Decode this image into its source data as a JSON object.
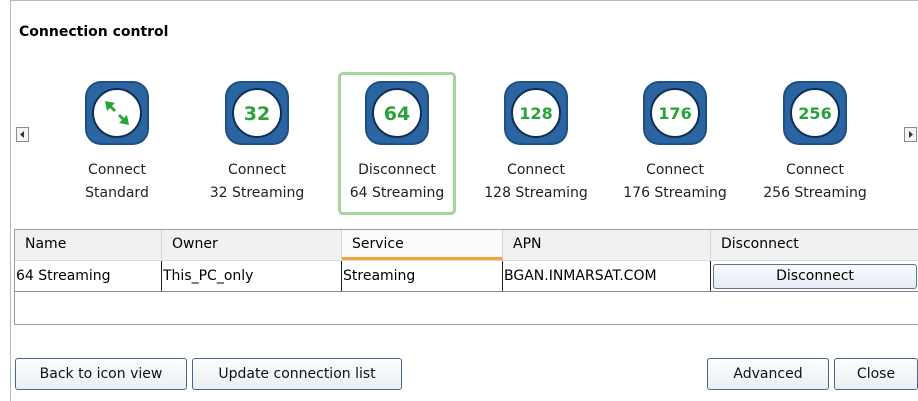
{
  "window": {
    "title": "Connection control"
  },
  "connections": [
    {
      "line1": "Connect",
      "line2": "Standard",
      "badge": "",
      "icon": "standard-connection-icon"
    },
    {
      "line1": "Connect",
      "line2": "32 Streaming",
      "badge": "32",
      "icon": "streaming-32-icon"
    },
    {
      "line1": "Disconnect",
      "line2": "64 Streaming",
      "badge": "64",
      "icon": "streaming-64-icon",
      "selected": true
    },
    {
      "line1": "Connect",
      "line2": "128 Streaming",
      "badge": "128",
      "icon": "streaming-128-icon"
    },
    {
      "line1": "Connect",
      "line2": "176 Streaming",
      "badge": "176",
      "icon": "streaming-176-icon"
    },
    {
      "line1": "Connect",
      "line2": "256 Streaming",
      "badge": "256",
      "icon": "streaming-256-icon"
    }
  ],
  "table": {
    "columns": [
      "Name",
      "Owner",
      "Service",
      "APN",
      "Disconnect"
    ],
    "sorted_column": "Service",
    "rows": [
      {
        "name": "64 Streaming",
        "owner": "This_PC_only",
        "service": "Streaming",
        "apn": "BGAN.INMARSAT.COM",
        "action": "Disconnect"
      }
    ]
  },
  "buttons": {
    "back": "Back to icon view",
    "update": "Update connection list",
    "advanced": "Advanced",
    "close": "Close"
  },
  "colors": {
    "icon_bg": "#1e4f86",
    "icon_green": "#27a33a",
    "selected_border": "#a6d49c",
    "sort_indicator": "#f0a43a"
  }
}
